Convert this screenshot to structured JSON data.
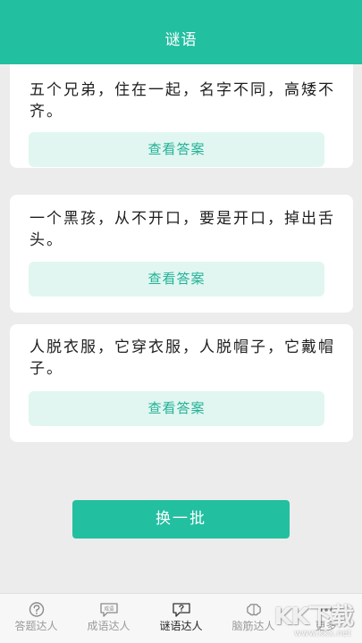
{
  "header": {
    "title": "谜语"
  },
  "riddles": [
    {
      "text": "五个兄弟，住在一起，名字不同，高矮不齐。",
      "button": "查看答案"
    },
    {
      "text": "一个黑孩，从不开口，要是开口，掉出舌头。",
      "button": "查看答案"
    },
    {
      "text": "人脱衣服，它穿衣服，人脱帽子，它戴帽子。",
      "button": "查看答案"
    }
  ],
  "refresh_button": "换一批",
  "tabs": [
    {
      "label": "答题达人",
      "icon": "question-circle-icon",
      "active": false
    },
    {
      "label": "成语达人",
      "icon": "idiom-chat-icon",
      "active": false
    },
    {
      "label": "谜语达人",
      "icon": "riddle-chat-icon",
      "active": true
    },
    {
      "label": "脑筋达人",
      "icon": "brain-icon",
      "active": false
    },
    {
      "label": "更多",
      "icon": "more-icon",
      "active": false
    }
  ],
  "idiom_icon_text": "成语",
  "watermark": {
    "text": "KK下载",
    "url": "www.kkx.net"
  },
  "colors": {
    "accent": "#22bfa0",
    "answer_bg": "#e1f6f1",
    "answer_text": "#22b196",
    "page_bg": "#ececec"
  }
}
